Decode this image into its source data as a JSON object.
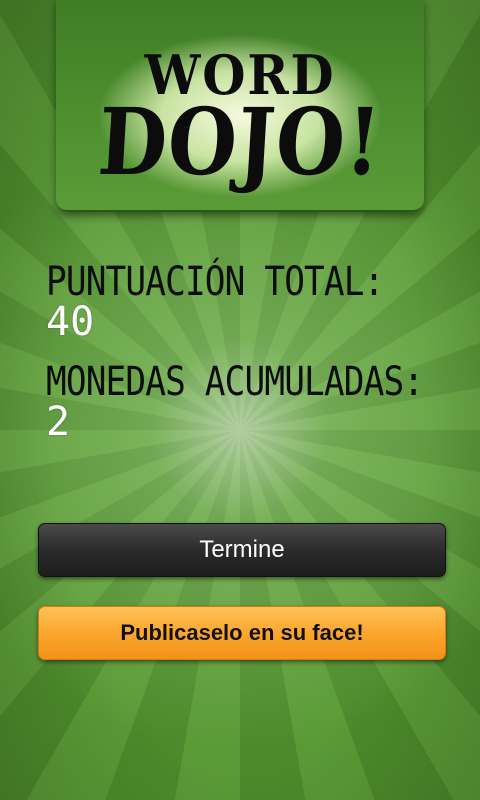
{
  "logo": {
    "line1": "WORD",
    "line2": "DOJO!"
  },
  "stats": {
    "score_label": "PUNTUACIÓN TOTAL:",
    "score_value": "40",
    "coins_label": "MONEDAS ACUMULADAS:",
    "coins_value": "2"
  },
  "buttons": {
    "finish_label": "Termine",
    "share_label": "Publicaselo en su face!"
  },
  "colors": {
    "background": "#4f8d2e",
    "finish_button": "#2b2b2b",
    "share_button": "#fba62e"
  }
}
